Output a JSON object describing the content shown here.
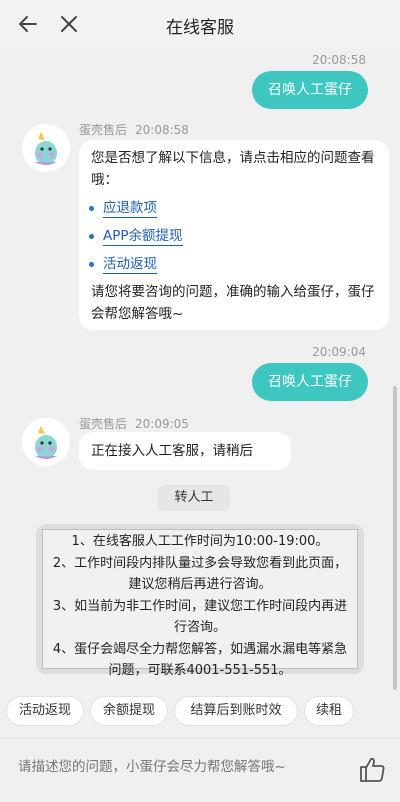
{
  "header": {
    "title": "在线客服",
    "back_icon": "back-arrow-icon",
    "close_icon": "close-icon"
  },
  "messages": {
    "m1_time": "20:08:58",
    "m1_text": "召唤人工蛋仔",
    "m2_sender": "蛋壳售后",
    "m2_time": "20:08:58",
    "m2_intro": "您是否想了解以下信息，请点击相应的问题查看哦：",
    "m2_options": [
      "应退款项",
      "APP余额提现",
      "活动返现"
    ],
    "m2_outro": "请您将要咨询的问题，准确的输入给蛋仔，蛋仔会帮您解答哦~",
    "m3_time": "20:09:04",
    "m3_text": "召唤人工蛋仔",
    "m4_sender": "蛋壳售后",
    "m4_time": "20:09:05",
    "m4_text": "正在接入人工客服，请稍后"
  },
  "transfer_label": "转人工",
  "notice": [
    "1、在线客服人工工作时间为10:00-19:00。",
    "2、工作时间段内排队量过多会导致您看到此页面，建议您稍后再进行咨询。",
    "3、如当前为非工作时间，建议您工作时间段内再进行咨询。",
    "4、蛋仔会竭尽全力帮您解答，如遇漏水漏电等紧急问题，可联系4001-551-551。"
  ],
  "quick_chips": [
    "活动返现",
    "余额提现",
    "结算后到账时效",
    "续租"
  ],
  "input": {
    "placeholder": "请描述您的问题，小蛋仔会尽力帮您解答哦~"
  },
  "colors": {
    "accent": "#3ec7c0",
    "link": "#1f5fb8",
    "background": "#f0f0f0"
  }
}
